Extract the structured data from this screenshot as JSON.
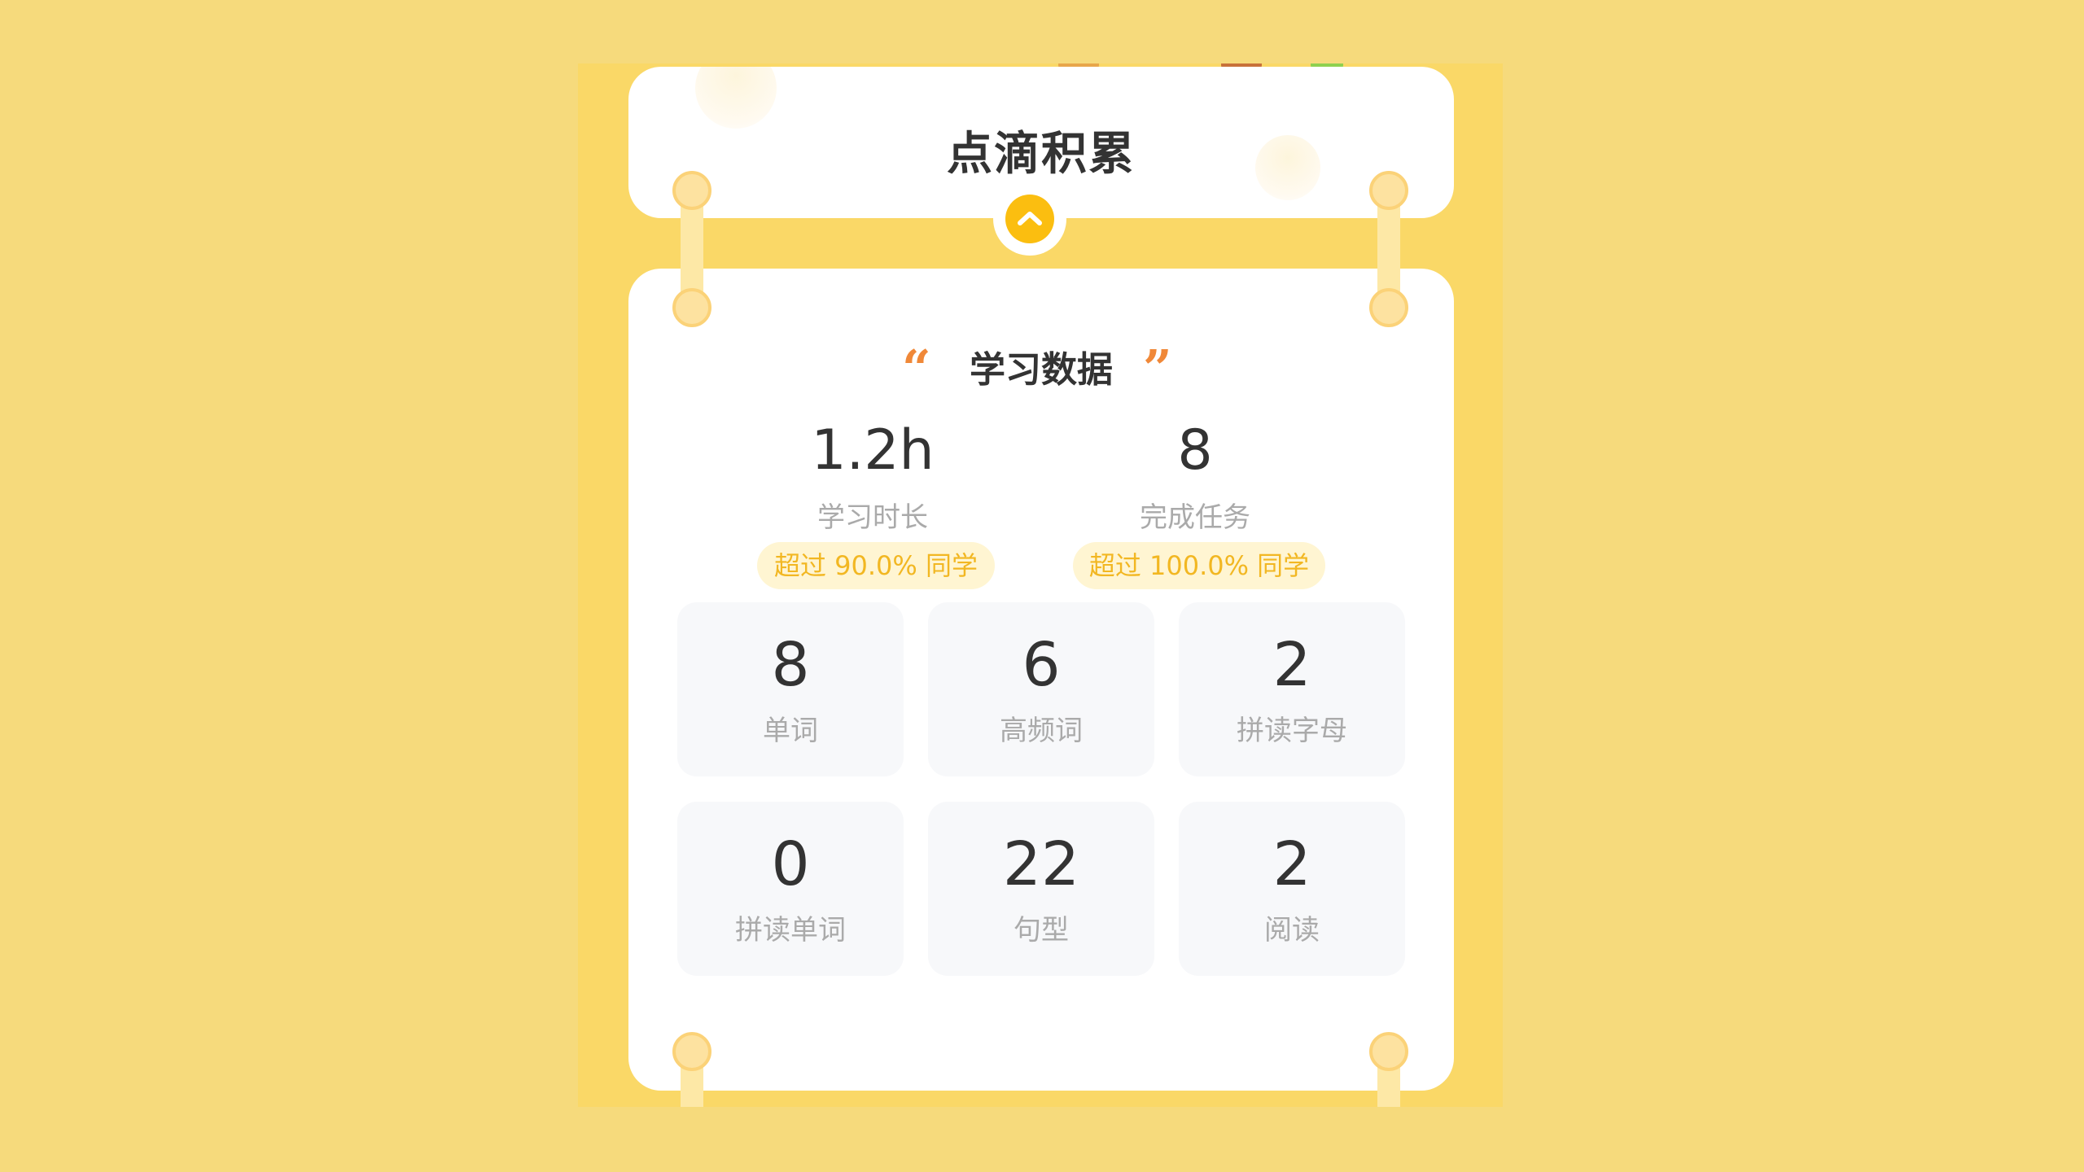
{
  "header": {
    "title": "点滴积累"
  },
  "study_data": {
    "title": "学习数据",
    "open_quote": "“",
    "close_quote": "”",
    "summary": [
      {
        "value": "1.2h",
        "label": "学习时长",
        "badge": "超过 90.0% 同学"
      },
      {
        "value": "8",
        "label": "完成任务",
        "badge": "超过 100.0% 同学"
      }
    ],
    "tiles": [
      {
        "value": "8",
        "label": "单词"
      },
      {
        "value": "6",
        "label": "高频词"
      },
      {
        "value": "2",
        "label": "拼读字母"
      },
      {
        "value": "0",
        "label": "拼读单词"
      },
      {
        "value": "22",
        "label": "句型"
      },
      {
        "value": "2",
        "label": "阅读"
      }
    ]
  },
  "icons": {
    "toggle": "chevron-up-icon"
  },
  "colors": {
    "background": "#f6da7c",
    "panel": "#fad867",
    "accent": "#fbbe10",
    "quote": "#f08838",
    "badge_text": "#f2b722",
    "badge_bg": "#fff5d2"
  }
}
